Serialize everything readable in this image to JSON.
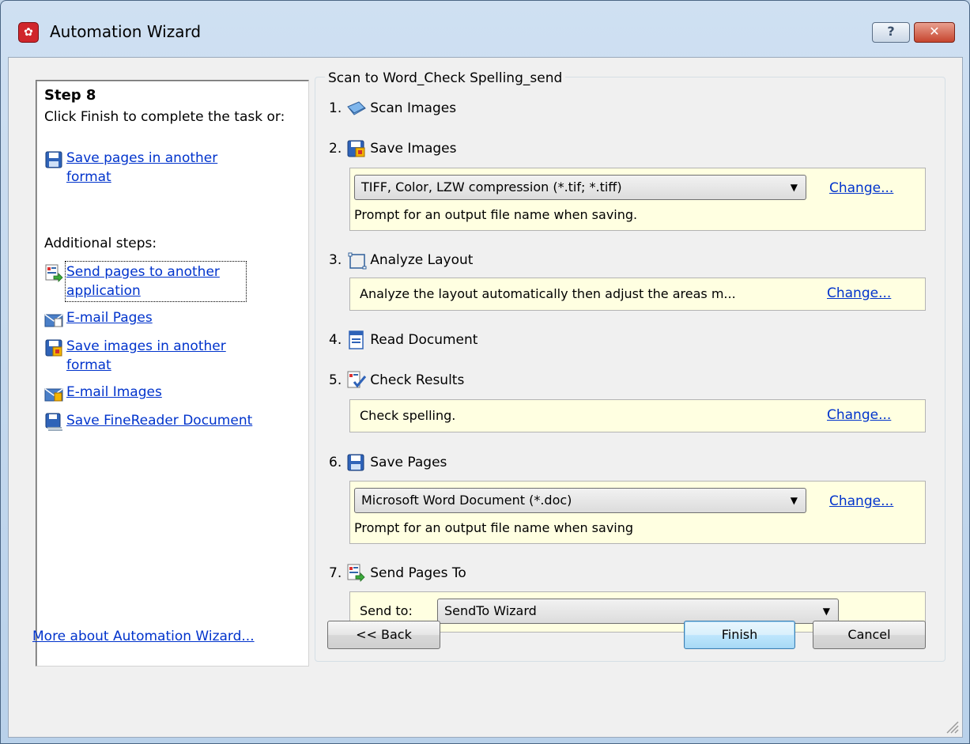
{
  "window": {
    "title": "Automation Wizard",
    "help_glyph": "?",
    "close_glyph": "✕"
  },
  "left": {
    "step_title": "Step 8",
    "step_desc": "Click Finish to complete the task or:",
    "primary_link": "Save pages in another format",
    "additional_label": "Additional steps:",
    "links": [
      {
        "label": "Send pages to another application",
        "icon": "send-pages-icon"
      },
      {
        "label": "E-mail Pages",
        "icon": "email-pages-icon"
      },
      {
        "label": "Save images in another format",
        "icon": "save-images-icon"
      },
      {
        "label": "E-mail Images",
        "icon": "email-images-icon"
      },
      {
        "label": "Save FineReader Document",
        "icon": "save-document-icon"
      }
    ],
    "more_link": "More about Automation Wizard..."
  },
  "task": {
    "name": "Scan to Word_Check Spelling_send",
    "steps": [
      {
        "num": "1.",
        "label": "Scan Images",
        "icon": "scanner-icon"
      },
      {
        "num": "2.",
        "label": "Save Images",
        "icon": "save-images-icon",
        "combo": "TIFF, Color, LZW compression (*.tif; *.tiff)",
        "note": "Prompt for an output file name when saving.",
        "change": "Change..."
      },
      {
        "num": "3.",
        "label": "Analyze Layout",
        "icon": "layout-icon",
        "note": "Analyze the layout automatically then adjust the areas m...",
        "change": "Change..."
      },
      {
        "num": "4.",
        "label": "Read Document",
        "icon": "read-document-icon"
      },
      {
        "num": "5.",
        "label": "Check Results",
        "icon": "check-results-icon",
        "note": "Check spelling.",
        "change": "Change..."
      },
      {
        "num": "6.",
        "label": "Save Pages",
        "icon": "save-pages-icon",
        "combo": "Microsoft Word Document (*.doc)",
        "note": "Prompt for an output file name when saving",
        "change": "Change..."
      },
      {
        "num": "7.",
        "label": "Send Pages To",
        "icon": "send-pages-icon",
        "send_label": "Send to:",
        "combo": "SendTo Wizard"
      }
    ]
  },
  "buttons": {
    "back": "<< Back",
    "finish": "Finish",
    "cancel": "Cancel"
  }
}
